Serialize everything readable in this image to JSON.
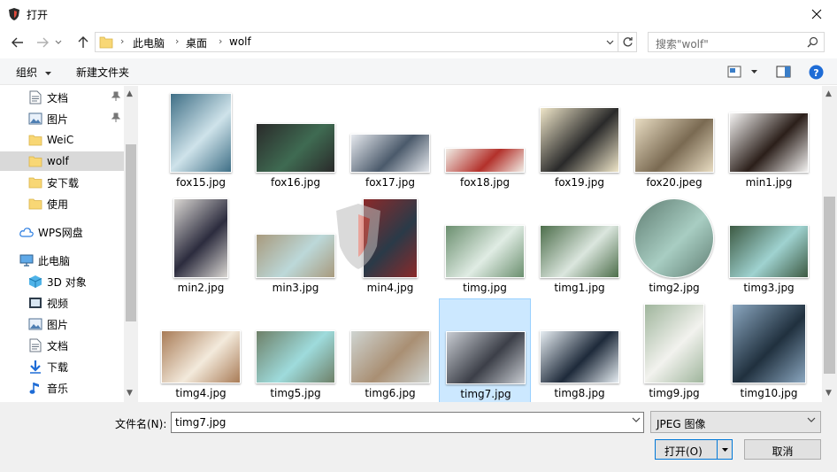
{
  "window": {
    "title": "打开"
  },
  "address": {
    "crumbs": [
      "此电脑",
      "桌面",
      "wolf"
    ]
  },
  "search": {
    "placeholder": "搜索\"wolf\""
  },
  "toolbar": {
    "organize_label": "组织",
    "new_folder_label": "新建文件夹"
  },
  "sidebar": {
    "items": [
      {
        "label": "文档",
        "icon": "document-icon",
        "pinned": true
      },
      {
        "label": "图片",
        "icon": "picture-icon",
        "pinned": true
      },
      {
        "label": "WeiC",
        "icon": "folder-icon",
        "pinned": false
      },
      {
        "label": "wolf",
        "icon": "folder-icon",
        "pinned": false,
        "selected": true
      },
      {
        "label": "安下载",
        "icon": "folder-icon",
        "pinned": false
      },
      {
        "label": "使用",
        "icon": "folder-icon",
        "pinned": false
      },
      {
        "label": "WPS网盘",
        "icon": "cloud-icon",
        "pinned": false
      },
      {
        "label": "此电脑",
        "icon": "computer-icon",
        "pinned": false
      },
      {
        "label": "3D 对象",
        "icon": "cube-icon",
        "pinned": false
      },
      {
        "label": "视频",
        "icon": "video-icon",
        "pinned": false
      },
      {
        "label": "图片",
        "icon": "picture-icon",
        "pinned": false
      },
      {
        "label": "文档",
        "icon": "document-icon",
        "pinned": false
      },
      {
        "label": "下载",
        "icon": "download-icon",
        "pinned": false
      },
      {
        "label": "音乐",
        "icon": "music-icon",
        "pinned": false
      }
    ]
  },
  "files": [
    {
      "name": "fox15.jpg",
      "colors": [
        "#3f6f86",
        "#cfe3ea"
      ]
    },
    {
      "name": "fox16.jpg",
      "colors": [
        "#2a2a2a",
        "#3f6b52"
      ]
    },
    {
      "name": "fox17.jpg",
      "colors": [
        "#e6e9ee",
        "#4b5a6b"
      ]
    },
    {
      "name": "fox18.jpg",
      "colors": [
        "#f1ede6",
        "#b3312b"
      ]
    },
    {
      "name": "fox19.jpg",
      "colors": [
        "#efe6c9",
        "#2a2a2a"
      ]
    },
    {
      "name": "fox20.jpeg",
      "colors": [
        "#e8dcc2",
        "#7a6a52"
      ]
    },
    {
      "name": "min1.jpg",
      "colors": [
        "#f3f2f1",
        "#2b1f1a"
      ]
    },
    {
      "name": "min2.jpg",
      "colors": [
        "#d9d6d2",
        "#2c2c3e"
      ]
    },
    {
      "name": "min3.jpg",
      "colors": [
        "#a89a7d",
        "#bcd8d9"
      ]
    },
    {
      "name": "min4.jpg",
      "colors": [
        "#8b2a2a",
        "#2a3a48"
      ]
    },
    {
      "name": "timg.jpg",
      "colors": [
        "#6b8f6f",
        "#e0ece4"
      ]
    },
    {
      "name": "timg1.jpg",
      "colors": [
        "#4d6e4b",
        "#dbe6de"
      ]
    },
    {
      "name": "timg2.jpg",
      "colors": [
        "#5f7d72",
        "#a8cdc2"
      ]
    },
    {
      "name": "timg3.jpg",
      "colors": [
        "#3d5a43",
        "#9fd2d0"
      ]
    },
    {
      "name": "timg4.jpg",
      "colors": [
        "#a97c57",
        "#f3eadc"
      ]
    },
    {
      "name": "timg5.jpg",
      "colors": [
        "#6e8068",
        "#9edbdc"
      ]
    },
    {
      "name": "timg6.jpg",
      "colors": [
        "#cfd4d1",
        "#a98f73"
      ]
    },
    {
      "name": "timg7.jpg",
      "colors": [
        "#c8ccd2",
        "#3c3f48"
      ],
      "selected": true
    },
    {
      "name": "timg8.jpg",
      "colors": [
        "#e6edf2",
        "#1e2a3a"
      ]
    },
    {
      "name": "timg9.jpg",
      "colors": [
        "#9fb59c",
        "#f2f2ee"
      ]
    },
    {
      "name": "timg10.jpg",
      "colors": [
        "#8aa6bf",
        "#20303e"
      ]
    }
  ],
  "bottom": {
    "filename_label": "文件名(N):",
    "filename_value": "timg7.jpg",
    "filetype_value": "JPEG 图像",
    "open_label": "打开(O)",
    "cancel_label": "取消"
  },
  "accent_color": "#0078d7"
}
